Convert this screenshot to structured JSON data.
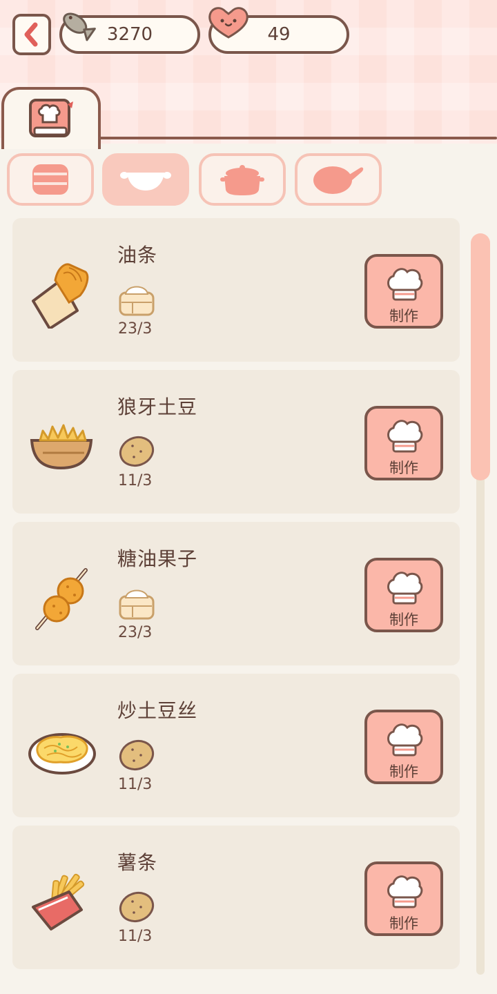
{
  "header": {
    "fish_count": "3270",
    "heart_count": "49"
  },
  "icons": {
    "back": "chevron-left-icon",
    "fish": "fish-icon",
    "heart": "heart-icon",
    "book": "recipe-book-icon",
    "categories": [
      "stacked-box-icon",
      "wok-icon",
      "pot-icon",
      "frying-pan-icon"
    ]
  },
  "category_tabs": {
    "active_index": 1
  },
  "dishes": [
    {
      "name": "油条",
      "icon": "youtiao-icon",
      "ingredient_icon": "flour-sack-icon",
      "count": "23/3",
      "button_label": "制作"
    },
    {
      "name": "狼牙土豆",
      "icon": "potato-wedges-icon",
      "ingredient_icon": "potato-icon",
      "count": "11/3",
      "button_label": "制作"
    },
    {
      "name": "糖油果子",
      "icon": "sugar-fritter-skewer-icon",
      "ingredient_icon": "flour-sack-icon",
      "count": "23/3",
      "button_label": "制作"
    },
    {
      "name": "炒土豆丝",
      "icon": "shredded-potato-plate-icon",
      "ingredient_icon": "potato-icon",
      "count": "11/3",
      "button_label": "制作"
    },
    {
      "name": "薯条",
      "icon": "french-fries-icon",
      "ingredient_icon": "potato-icon",
      "count": "11/3",
      "button_label": "制作"
    }
  ],
  "colors": {
    "accent": "#fbb7a9",
    "outline": "#7a564b",
    "card_bg": "#f1eadf"
  }
}
